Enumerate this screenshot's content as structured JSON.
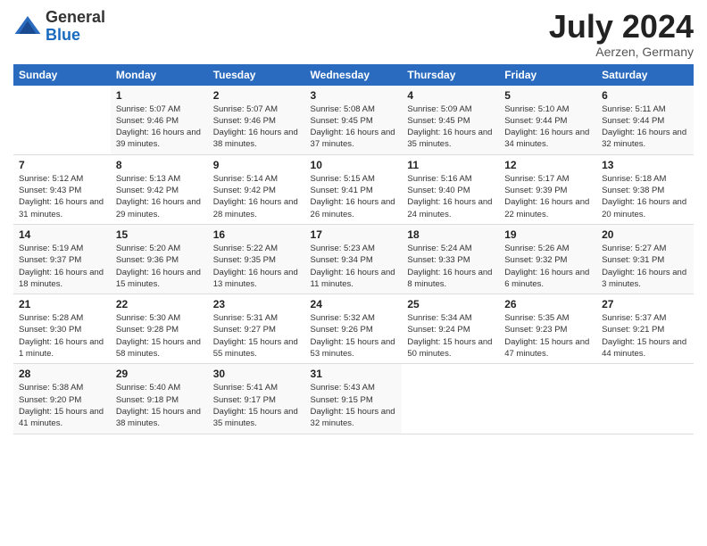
{
  "logo": {
    "general": "General",
    "blue": "Blue"
  },
  "title": {
    "month_year": "July 2024",
    "location": "Aerzen, Germany"
  },
  "headers": [
    "Sunday",
    "Monday",
    "Tuesday",
    "Wednesday",
    "Thursday",
    "Friday",
    "Saturday"
  ],
  "weeks": [
    [
      {
        "day": "",
        "sunrise": "",
        "sunset": "",
        "daylight": ""
      },
      {
        "day": "1",
        "sunrise": "Sunrise: 5:07 AM",
        "sunset": "Sunset: 9:46 PM",
        "daylight": "Daylight: 16 hours and 39 minutes."
      },
      {
        "day": "2",
        "sunrise": "Sunrise: 5:07 AM",
        "sunset": "Sunset: 9:46 PM",
        "daylight": "Daylight: 16 hours and 38 minutes."
      },
      {
        "day": "3",
        "sunrise": "Sunrise: 5:08 AM",
        "sunset": "Sunset: 9:45 PM",
        "daylight": "Daylight: 16 hours and 37 minutes."
      },
      {
        "day": "4",
        "sunrise": "Sunrise: 5:09 AM",
        "sunset": "Sunset: 9:45 PM",
        "daylight": "Daylight: 16 hours and 35 minutes."
      },
      {
        "day": "5",
        "sunrise": "Sunrise: 5:10 AM",
        "sunset": "Sunset: 9:44 PM",
        "daylight": "Daylight: 16 hours and 34 minutes."
      },
      {
        "day": "6",
        "sunrise": "Sunrise: 5:11 AM",
        "sunset": "Sunset: 9:44 PM",
        "daylight": "Daylight: 16 hours and 32 minutes."
      }
    ],
    [
      {
        "day": "7",
        "sunrise": "Sunrise: 5:12 AM",
        "sunset": "Sunset: 9:43 PM",
        "daylight": "Daylight: 16 hours and 31 minutes."
      },
      {
        "day": "8",
        "sunrise": "Sunrise: 5:13 AM",
        "sunset": "Sunset: 9:42 PM",
        "daylight": "Daylight: 16 hours and 29 minutes."
      },
      {
        "day": "9",
        "sunrise": "Sunrise: 5:14 AM",
        "sunset": "Sunset: 9:42 PM",
        "daylight": "Daylight: 16 hours and 28 minutes."
      },
      {
        "day": "10",
        "sunrise": "Sunrise: 5:15 AM",
        "sunset": "Sunset: 9:41 PM",
        "daylight": "Daylight: 16 hours and 26 minutes."
      },
      {
        "day": "11",
        "sunrise": "Sunrise: 5:16 AM",
        "sunset": "Sunset: 9:40 PM",
        "daylight": "Daylight: 16 hours and 24 minutes."
      },
      {
        "day": "12",
        "sunrise": "Sunrise: 5:17 AM",
        "sunset": "Sunset: 9:39 PM",
        "daylight": "Daylight: 16 hours and 22 minutes."
      },
      {
        "day": "13",
        "sunrise": "Sunrise: 5:18 AM",
        "sunset": "Sunset: 9:38 PM",
        "daylight": "Daylight: 16 hours and 20 minutes."
      }
    ],
    [
      {
        "day": "14",
        "sunrise": "Sunrise: 5:19 AM",
        "sunset": "Sunset: 9:37 PM",
        "daylight": "Daylight: 16 hours and 18 minutes."
      },
      {
        "day": "15",
        "sunrise": "Sunrise: 5:20 AM",
        "sunset": "Sunset: 9:36 PM",
        "daylight": "Daylight: 16 hours and 15 minutes."
      },
      {
        "day": "16",
        "sunrise": "Sunrise: 5:22 AM",
        "sunset": "Sunset: 9:35 PM",
        "daylight": "Daylight: 16 hours and 13 minutes."
      },
      {
        "day": "17",
        "sunrise": "Sunrise: 5:23 AM",
        "sunset": "Sunset: 9:34 PM",
        "daylight": "Daylight: 16 hours and 11 minutes."
      },
      {
        "day": "18",
        "sunrise": "Sunrise: 5:24 AM",
        "sunset": "Sunset: 9:33 PM",
        "daylight": "Daylight: 16 hours and 8 minutes."
      },
      {
        "day": "19",
        "sunrise": "Sunrise: 5:26 AM",
        "sunset": "Sunset: 9:32 PM",
        "daylight": "Daylight: 16 hours and 6 minutes."
      },
      {
        "day": "20",
        "sunrise": "Sunrise: 5:27 AM",
        "sunset": "Sunset: 9:31 PM",
        "daylight": "Daylight: 16 hours and 3 minutes."
      }
    ],
    [
      {
        "day": "21",
        "sunrise": "Sunrise: 5:28 AM",
        "sunset": "Sunset: 9:30 PM",
        "daylight": "Daylight: 16 hours and 1 minute."
      },
      {
        "day": "22",
        "sunrise": "Sunrise: 5:30 AM",
        "sunset": "Sunset: 9:28 PM",
        "daylight": "Daylight: 15 hours and 58 minutes."
      },
      {
        "day": "23",
        "sunrise": "Sunrise: 5:31 AM",
        "sunset": "Sunset: 9:27 PM",
        "daylight": "Daylight: 15 hours and 55 minutes."
      },
      {
        "day": "24",
        "sunrise": "Sunrise: 5:32 AM",
        "sunset": "Sunset: 9:26 PM",
        "daylight": "Daylight: 15 hours and 53 minutes."
      },
      {
        "day": "25",
        "sunrise": "Sunrise: 5:34 AM",
        "sunset": "Sunset: 9:24 PM",
        "daylight": "Daylight: 15 hours and 50 minutes."
      },
      {
        "day": "26",
        "sunrise": "Sunrise: 5:35 AM",
        "sunset": "Sunset: 9:23 PM",
        "daylight": "Daylight: 15 hours and 47 minutes."
      },
      {
        "day": "27",
        "sunrise": "Sunrise: 5:37 AM",
        "sunset": "Sunset: 9:21 PM",
        "daylight": "Daylight: 15 hours and 44 minutes."
      }
    ],
    [
      {
        "day": "28",
        "sunrise": "Sunrise: 5:38 AM",
        "sunset": "Sunset: 9:20 PM",
        "daylight": "Daylight: 15 hours and 41 minutes."
      },
      {
        "day": "29",
        "sunrise": "Sunrise: 5:40 AM",
        "sunset": "Sunset: 9:18 PM",
        "daylight": "Daylight: 15 hours and 38 minutes."
      },
      {
        "day": "30",
        "sunrise": "Sunrise: 5:41 AM",
        "sunset": "Sunset: 9:17 PM",
        "daylight": "Daylight: 15 hours and 35 minutes."
      },
      {
        "day": "31",
        "sunrise": "Sunrise: 5:43 AM",
        "sunset": "Sunset: 9:15 PM",
        "daylight": "Daylight: 15 hours and 32 minutes."
      },
      {
        "day": "",
        "sunrise": "",
        "sunset": "",
        "daylight": ""
      },
      {
        "day": "",
        "sunrise": "",
        "sunset": "",
        "daylight": ""
      },
      {
        "day": "",
        "sunrise": "",
        "sunset": "",
        "daylight": ""
      }
    ]
  ]
}
